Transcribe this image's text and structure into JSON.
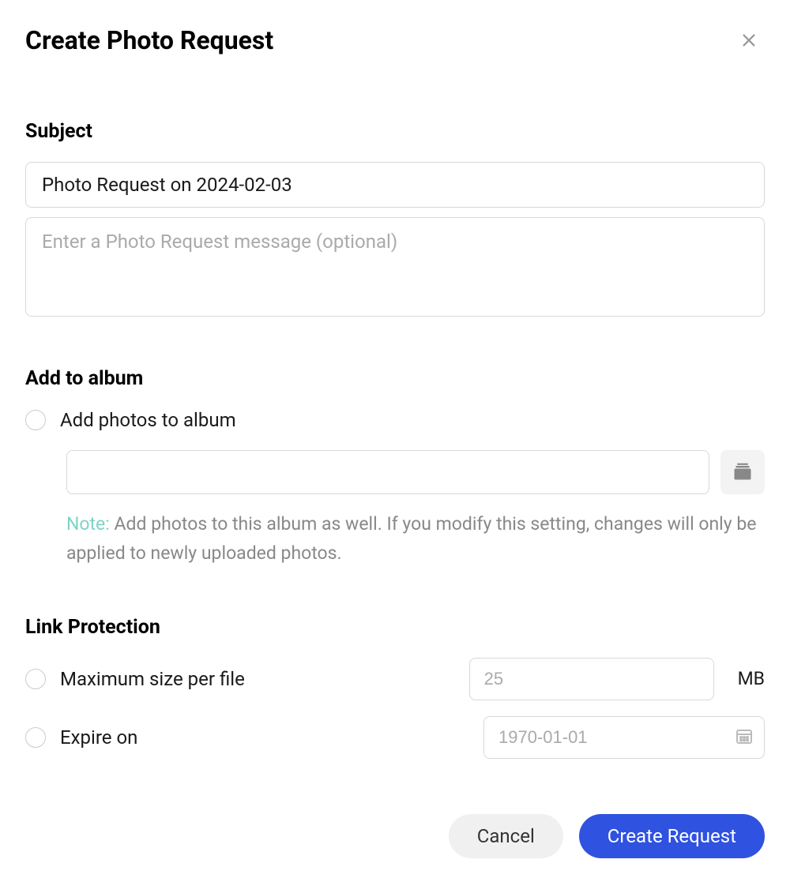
{
  "header": {
    "title": "Create Photo Request"
  },
  "subject": {
    "section_title": "Subject",
    "value": "Photo Request on 2024-02-03",
    "message_placeholder": "Enter a Photo Request message (optional)"
  },
  "album": {
    "section_title": "Add to album",
    "checkbox_label": "Add photos to album",
    "input_value": "",
    "note_label": "Note:",
    "note_text": "Add photos to this album as well. If you modify this setting, changes will only be applied to newly uploaded photos."
  },
  "protection": {
    "section_title": "Link Protection",
    "max_size_label": "Maximum size per file",
    "max_size_placeholder": "25",
    "max_size_unit": "MB",
    "expire_label": "Expire on",
    "expire_placeholder": "1970-01-01"
  },
  "footer": {
    "cancel_label": "Cancel",
    "submit_label": "Create Request"
  }
}
